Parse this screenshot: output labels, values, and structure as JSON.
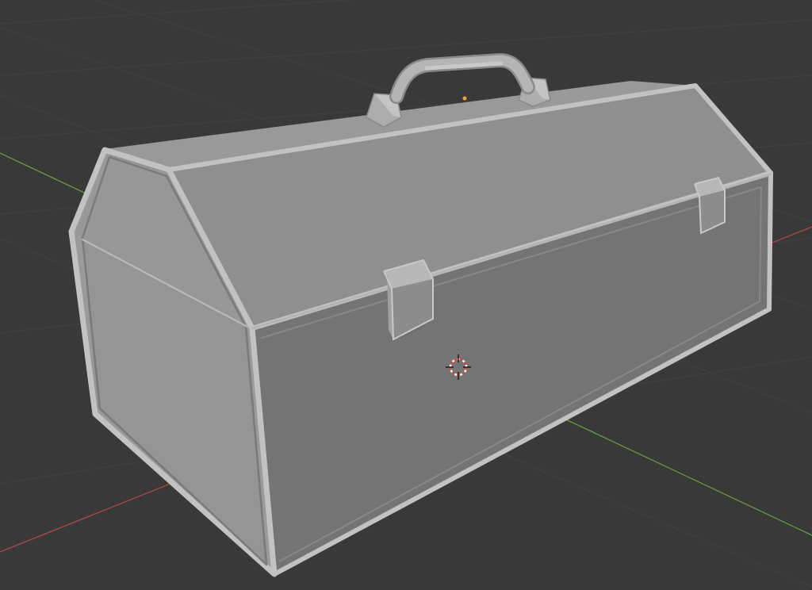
{
  "app": {
    "name": "3D viewport",
    "mode": "object",
    "shading": "solid"
  },
  "scene": {
    "object": "toolbox-mesh",
    "parts": [
      "body",
      "lid",
      "handle",
      "handle-mount-left",
      "handle-mount-right",
      "latch-front",
      "latch-right",
      "frame-edges"
    ],
    "cursor": "3d-cursor",
    "origin": "object-origin"
  },
  "colors": {
    "background": "#393939",
    "grid_line": "#424242",
    "x_axis": "#b14747",
    "y_axis": "#6a9a3a",
    "mesh_light": "#a7a7a7",
    "mesh_mid": "#8f8f8f",
    "mesh_dark": "#727272",
    "origin_dot": "#f3a03a",
    "cursor_red": "#d9433d",
    "cursor_white": "#ffffff"
  }
}
